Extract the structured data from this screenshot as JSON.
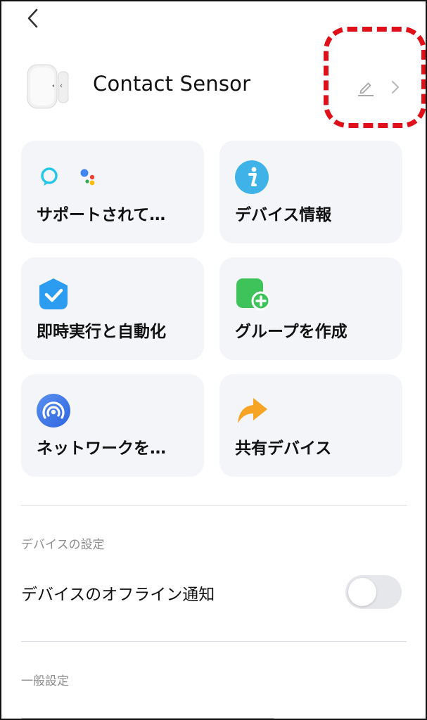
{
  "header": {
    "back_icon": "chevron-left-icon",
    "device_name": "Contact Sensor",
    "edit_icon": "pencil-icon",
    "forward_icon": "chevron-right-icon",
    "highlight_color": "#e0101b"
  },
  "tiles": [
    {
      "label": "サポートされて…",
      "icon": "voice-assistants-icon"
    },
    {
      "label": "デバイス情報",
      "icon": "info-icon"
    },
    {
      "label": "即時実行と自動化",
      "icon": "automation-check-icon"
    },
    {
      "label": "グループを作成",
      "icon": "create-group-icon"
    },
    {
      "label": "ネットワークを…",
      "icon": "network-icon"
    },
    {
      "label": "共有デバイス",
      "icon": "share-arrow-icon"
    }
  ],
  "device_settings": {
    "heading": "デバイスの設定",
    "offline_notification": {
      "label": "デバイスのオフライン通知",
      "enabled": false
    }
  },
  "general_settings": {
    "heading": "一般設定"
  },
  "colors": {
    "tile_bg": "#f4f5f9",
    "info_blue": "#3fb3e8",
    "green": "#3ec25a",
    "share_orange": "#f7a323",
    "network_blue": "#2f78e8"
  }
}
